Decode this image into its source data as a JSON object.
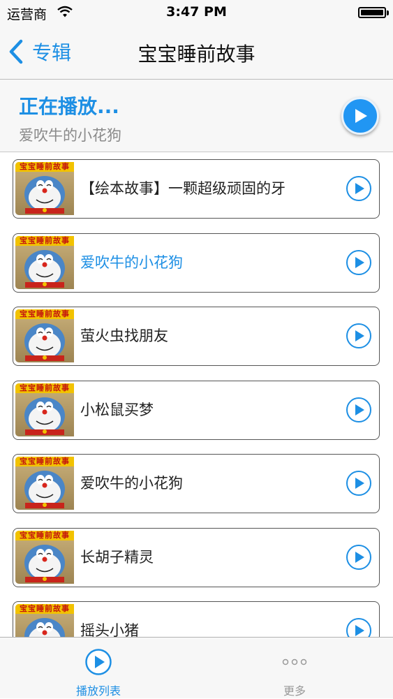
{
  "status_bar": {
    "carrier": "运营商",
    "time": "3:47 PM",
    "wifi_icon": "wifi-icon",
    "battery_icon": "battery-icon"
  },
  "nav": {
    "back_label": "专辑",
    "title": "宝宝睡前故事",
    "back_icon": "chevron-left-icon"
  },
  "now_playing": {
    "heading": "正在播放...",
    "song": "爱吹牛的小花狗",
    "play_icon": "play-icon"
  },
  "thumbnail_banner": "宝宝睡前故事",
  "tracks": [
    {
      "title": "【绘本故事】一颗超级顽固的牙",
      "active": false
    },
    {
      "title": "爱吹牛的小花狗",
      "active": true
    },
    {
      "title": "萤火虫找朋友",
      "active": false
    },
    {
      "title": "小松鼠买梦",
      "active": false
    },
    {
      "title": "爱吹牛的小花狗",
      "active": false
    },
    {
      "title": "长胡子精灵",
      "active": false
    },
    {
      "title": "摇头小猪",
      "active": false
    }
  ],
  "tab_bar": {
    "tabs": [
      {
        "label": "播放列表",
        "icon": "play-circle-icon",
        "selected": true
      },
      {
        "label": "更多",
        "icon": "more-dots-icon",
        "selected": false
      }
    ]
  },
  "colors": {
    "accent": "#1d8fe4",
    "play_fill": "#2196f3",
    "background": "#ffffff",
    "bar_background": "#f7f7f7"
  }
}
